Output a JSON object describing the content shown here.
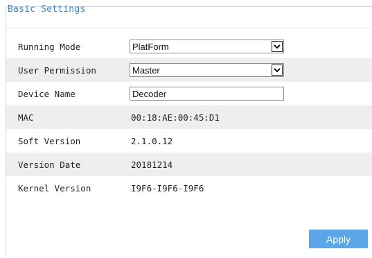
{
  "panel": {
    "title": "Basic Settings"
  },
  "fields": {
    "running_mode": {
      "label": "Running Mode",
      "value": "PlatForm"
    },
    "user_permission": {
      "label": "User Permission",
      "value": "Master"
    },
    "device_name": {
      "label": "Device Name",
      "value": "Decoder"
    },
    "mac": {
      "label": "MAC",
      "value": "00:18:AE:00:45:D1"
    },
    "soft_version": {
      "label": "Soft Version",
      "value": "2.1.0.12"
    },
    "version_date": {
      "label": "Version Date",
      "value": "20181214"
    },
    "kernel_version": {
      "label": "Kernel Version",
      "value": "I9F6-I9F6-I9F6"
    }
  },
  "actions": {
    "apply_label": "Apply"
  },
  "colors": {
    "title": "#3a86c8",
    "apply_button": "#5aa6e8",
    "row_shade": "#eeeeee"
  }
}
